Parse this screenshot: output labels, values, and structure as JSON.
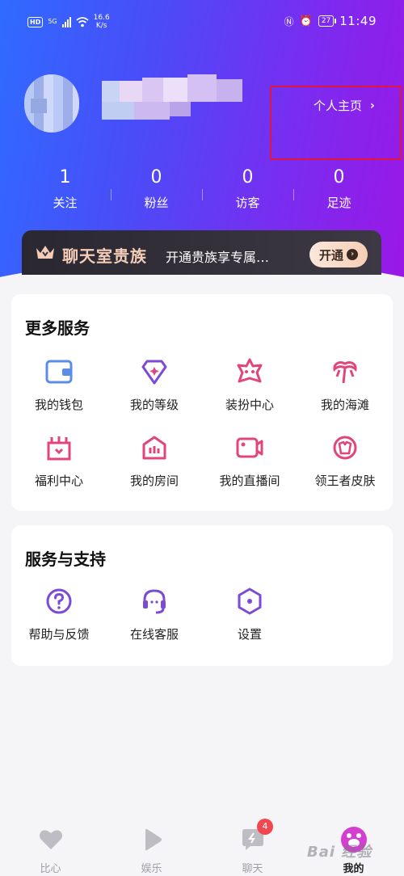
{
  "status_bar": {
    "network_type": "5G",
    "hd_label": "HD",
    "net_speed_value": "16.6",
    "net_speed_unit": "K/s",
    "battery": "27",
    "time": "11:49"
  },
  "profile": {
    "link_label": "个人主页"
  },
  "stats": [
    {
      "value": "1",
      "label": "关注"
    },
    {
      "value": "0",
      "label": "粉丝"
    },
    {
      "value": "0",
      "label": "访客"
    },
    {
      "value": "0",
      "label": "足迹"
    }
  ],
  "noble_banner": {
    "title": "聊天室贵族",
    "description": "开通贵族享专属…",
    "button_label": "开通",
    "accent_color": "#f3cdb7"
  },
  "more_services": {
    "title": "更多服务",
    "items": [
      {
        "label": "我的钱包",
        "icon": "wallet-icon"
      },
      {
        "label": "我的等级",
        "icon": "level-icon"
      },
      {
        "label": "装扮中心",
        "icon": "dress-up-icon"
      },
      {
        "label": "我的海滩",
        "icon": "beach-icon"
      },
      {
        "label": "福利中心",
        "icon": "welfare-icon"
      },
      {
        "label": "我的房间",
        "icon": "room-icon"
      },
      {
        "label": "我的直播间",
        "icon": "live-room-icon"
      },
      {
        "label": "领王者皮肤",
        "icon": "skin-icon"
      }
    ]
  },
  "service_support": {
    "title": "服务与支持",
    "items": [
      {
        "label": "帮助与反馈",
        "icon": "help-icon"
      },
      {
        "label": "在线客服",
        "icon": "customer-service-icon"
      },
      {
        "label": "设置",
        "icon": "settings-icon"
      }
    ]
  },
  "bottom_nav": {
    "items": [
      {
        "label": "比心",
        "icon": "heart-icon"
      },
      {
        "label": "娱乐",
        "icon": "play-icon"
      },
      {
        "label": "聊天",
        "icon": "chat-icon"
      },
      {
        "label": "我的",
        "icon": "profile-icon"
      }
    ],
    "chat_badge": "4"
  },
  "watermark": "Bai 经验",
  "colors": {
    "gradient_start": "#2f6bff",
    "gradient_end": "#9b17e6",
    "wallet_blue": "#5b8de8",
    "service_purple": "#7b4bd8",
    "pink": "#e2457c",
    "highlight_red": "#e0173a"
  }
}
